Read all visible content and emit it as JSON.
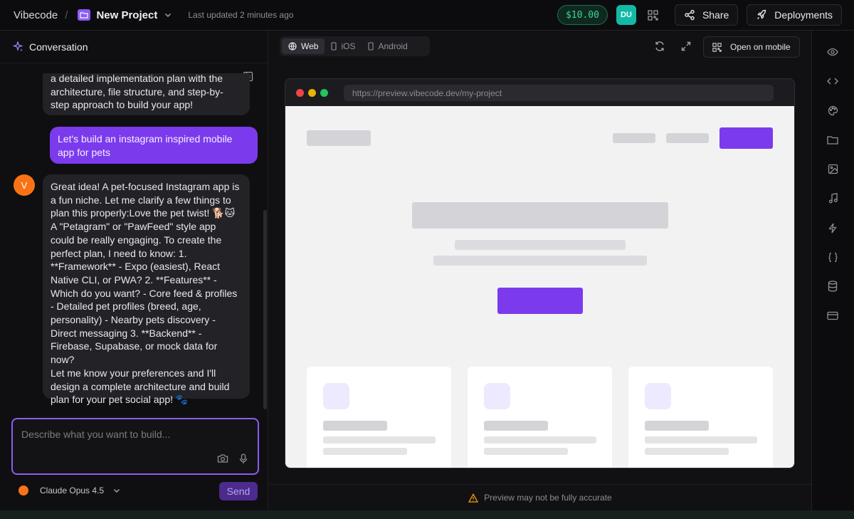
{
  "topbar": {
    "brand": "Vibecode",
    "separator": "/",
    "project_name": "New Project",
    "updated": "Last updated 2 minutes ago",
    "credits": "$10.00",
    "avatar_initials": "DU",
    "share_label": "Share",
    "deployments_label": "Deployments"
  },
  "conversation": {
    "title": "Conversation",
    "messages": [
      {
        "role": "assistant",
        "lines": [
          "a detailed implementation plan with the",
          "architecture, file structure, and step-by-",
          "step approach to build your app!"
        ]
      },
      {
        "role": "user",
        "lines": [
          "Let's build an instagram inspired mobile",
          "app for pets"
        ]
      },
      {
        "role": "assistant",
        "avatar": "V",
        "lines": [
          "Great idea! A pet-focused Instagram app is",
          "a fun niche. Let me clarify a few things to",
          "plan this properly:Love the pet twist! 🐕🐱",
          "A \"Petagram\" or \"PawFeed\" style app",
          "could be really engaging. To create the",
          "perfect plan, I need to know: 1.",
          "**Framework** - Expo (easiest), React",
          "Native CLI, or PWA? 2. **Features** -",
          "Which do you want? - Core feed & profiles",
          "- Detailed pet profiles (breed, age,",
          "personality) - Nearby pets discovery -",
          "Direct messaging 3. **Backend** -",
          "Firebase, Supabase, or mock data for now?",
          "Let me know your preferences and I'll",
          "design a complete architecture and build",
          "plan for your pet social app! 🐾"
        ]
      }
    ],
    "composer_placeholder": "Describe what you want to build...",
    "model_name": "Claude Opus 4.5",
    "send_label": "Send"
  },
  "preview": {
    "tabs": [
      {
        "label": "Web",
        "icon": "globe-icon",
        "active": true
      },
      {
        "label": "iOS",
        "icon": "phone-icon",
        "active": false
      },
      {
        "label": "Android",
        "icon": "phone-icon",
        "active": false
      }
    ],
    "open_mobile_label": "Open on mobile",
    "url": "https://preview.vibecode.dev/my-project",
    "footer_note": "Preview may not be fully accurate"
  },
  "rail": {
    "icons": [
      "eye-icon",
      "code-icon",
      "palette-icon",
      "folder-icon",
      "image-icon",
      "music-icon",
      "lightning-icon",
      "braces-icon",
      "database-icon",
      "card-icon"
    ]
  },
  "colors": {
    "accent": "#7c3aed",
    "credit_green": "#3fd59a",
    "avatar_teal": "#14b8a6",
    "model_orange": "#f97316"
  }
}
